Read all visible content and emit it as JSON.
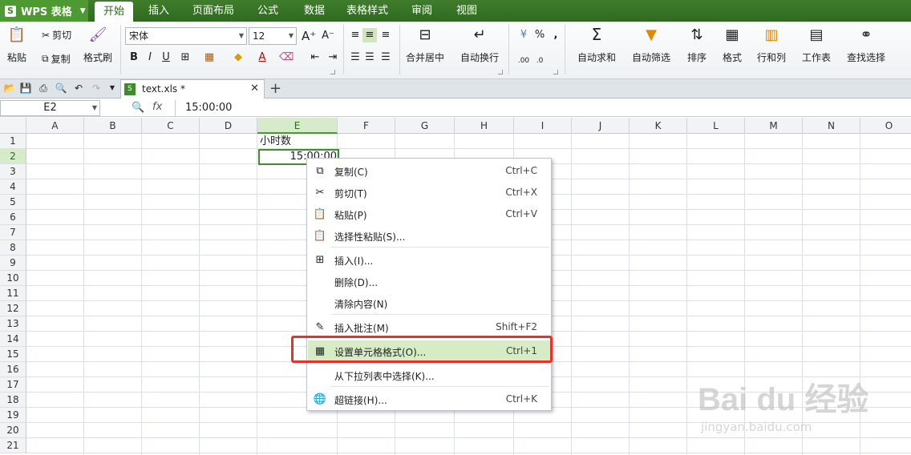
{
  "app": {
    "name": "WPS 表格"
  },
  "menu_tabs": [
    "开始",
    "插入",
    "页面布局",
    "公式",
    "数据",
    "表格样式",
    "审阅",
    "视图"
  ],
  "ribbon": {
    "paste": "粘贴",
    "cut": "剪切",
    "copy": "复制",
    "format_painter": "格式刷",
    "font_name": "宋体",
    "font_size": "12",
    "merge_center": "合并居中",
    "wrap_text": "自动换行",
    "autosum": "自动求和",
    "autofilter": "自动筛选",
    "sort": "排序",
    "format": "格式",
    "rows_cols": "行和列",
    "worksheet": "工作表",
    "find_select": "查找选择",
    "percent": "%",
    "comma": ","
  },
  "document": {
    "tab_name": "text.xls *"
  },
  "formula_bar": {
    "name_box": "E2",
    "fx": "fx",
    "content": "15:00:00"
  },
  "columns": [
    "A",
    "B",
    "C",
    "D",
    "E",
    "F",
    "G",
    "H",
    "I",
    "J",
    "K",
    "L",
    "M",
    "N",
    "O"
  ],
  "rows": [
    "1",
    "2",
    "3",
    "4",
    "5",
    "6",
    "7",
    "8",
    "9",
    "10",
    "11",
    "12",
    "13",
    "14",
    "15",
    "16",
    "17",
    "18",
    "19",
    "20",
    "21"
  ],
  "cells": {
    "E1": "小时数",
    "E2": "15:00:00"
  },
  "context_menu": [
    {
      "label": "复制(C)",
      "shortcut": "Ctrl+C",
      "icon": "copy-icon"
    },
    {
      "label": "剪切(T)",
      "shortcut": "Ctrl+X",
      "icon": "cut-icon"
    },
    {
      "label": "粘贴(P)",
      "shortcut": "Ctrl+V",
      "icon": "paste-icon"
    },
    {
      "label": "选择性粘贴(S)...",
      "shortcut": "",
      "icon": "paste-special-icon"
    },
    {
      "label": "插入(I)...",
      "shortcut": "",
      "icon": "insert-icon"
    },
    {
      "label": "删除(D)...",
      "shortcut": "",
      "icon": ""
    },
    {
      "label": "清除内容(N)",
      "shortcut": "",
      "icon": ""
    },
    {
      "label": "插入批注(M)",
      "shortcut": "Shift+F2",
      "icon": "comment-icon"
    },
    {
      "label": "设置单元格格式(O)...",
      "shortcut": "Ctrl+1",
      "icon": "format-cells-icon"
    },
    {
      "label": "从下拉列表中选择(K)...",
      "shortcut": "",
      "icon": ""
    },
    {
      "label": "超链接(H)...",
      "shortcut": "Ctrl+K",
      "icon": "hyperlink-icon"
    }
  ],
  "watermark": {
    "logo": "Bai du 经验",
    "url": "jingyan.baidu.com"
  },
  "colors": {
    "menubar": "#3f7d2c",
    "selection": "#3f8f2a",
    "highlight": "#d5ecc5",
    "annotation": "#e5332a"
  }
}
